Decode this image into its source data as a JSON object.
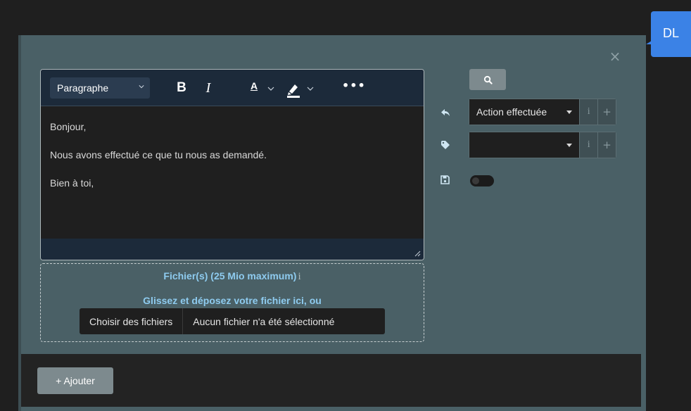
{
  "user": {
    "initials": "DL",
    "badge_color": "#3b82e6"
  },
  "dialog": {
    "close_glyph": "×"
  },
  "editor": {
    "block_format": "Paragraphe",
    "bold_label": "B",
    "italic_label": "I",
    "text_color_label": "A",
    "more_label": "•••",
    "paragraphs": [
      "Bonjour,",
      "Nous avons effectué ce que tu nous as demandé.",
      "Bien à toi,"
    ]
  },
  "dropzone": {
    "title": "Fichier(s) (25 Mio maximum)",
    "info_glyph": "i",
    "subtitle": "Glissez et déposez votre fichier ici, ou",
    "choose_button": "Choisir des fichiers",
    "no_file_text": "Aucun fichier n'a été sélectionné"
  },
  "sidebar": {
    "action_select": {
      "value": "Action effectuée",
      "info": "i",
      "plus": "+"
    },
    "tag_select": {
      "value": "",
      "info": "i",
      "plus": "+"
    },
    "save_toggle": {
      "on": false
    }
  },
  "footer": {
    "add_button": "+ Ajouter"
  },
  "icons": {
    "reply": "reply-icon",
    "tag": "tag-icon",
    "save": "save-icon",
    "search": "search-icon"
  },
  "colors": {
    "panel": "#4a6066",
    "toolbar": "#1c2a3a",
    "link_blue": "#8ecbef",
    "button_gray": "#7d8a8e"
  }
}
